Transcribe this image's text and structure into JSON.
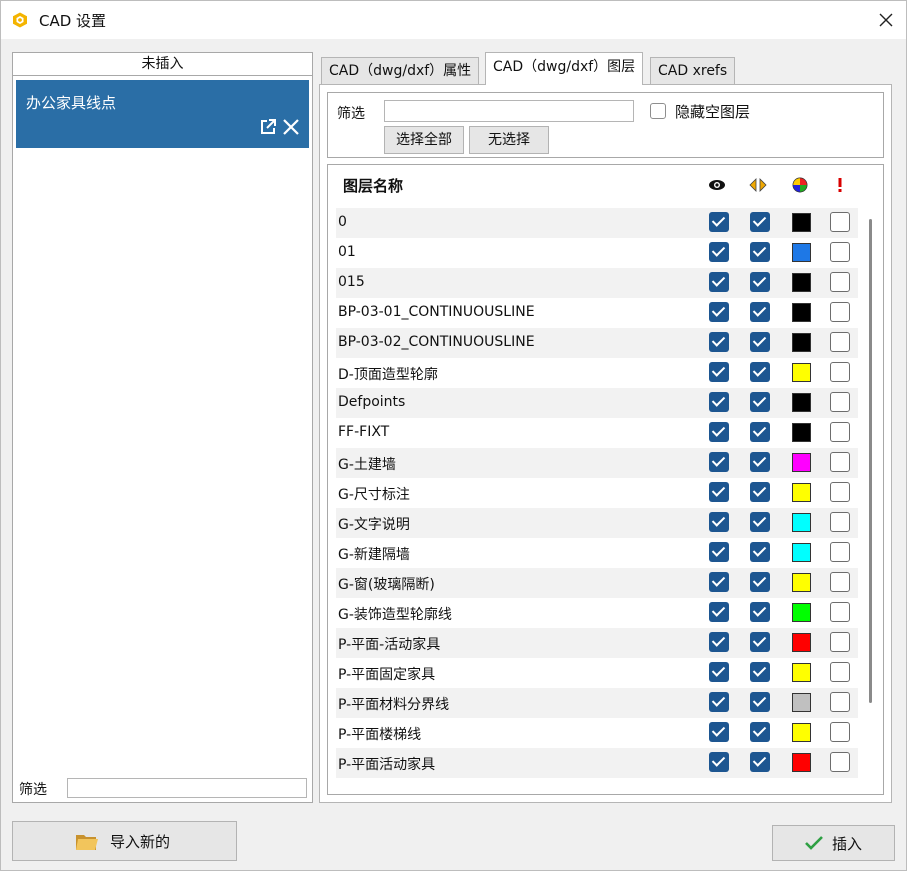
{
  "window": {
    "title": "CAD 设置"
  },
  "left": {
    "header": "未插入",
    "items": [
      {
        "label": "办公家具线点"
      }
    ],
    "filter_label": "筛选",
    "filter_value": ""
  },
  "tabs": [
    {
      "label": "CAD（dwg/dxf）属性",
      "active": false
    },
    {
      "label": "CAD（dwg/dxf）图层",
      "active": true
    },
    {
      "label": "CAD xrefs",
      "active": false
    }
  ],
  "filter": {
    "label": "筛选",
    "value": "",
    "hide_empty_label": "隐藏空图层",
    "hide_empty_checked": false,
    "select_all_label": "选择全部",
    "select_none_label": "无选择"
  },
  "table": {
    "header_name": "图层名称",
    "header_icons": [
      "eye-icon",
      "lock-icon",
      "color-wheel-icon",
      "warning-icon"
    ],
    "layers": [
      {
        "name": "0",
        "visible": true,
        "locked": true,
        "color": "#000000",
        "flag": false
      },
      {
        "name": "01",
        "visible": true,
        "locked": true,
        "color": "#1e78e6",
        "flag": false
      },
      {
        "name": "015",
        "visible": true,
        "locked": true,
        "color": "#000000",
        "flag": false
      },
      {
        "name": "BP-03-01_CONTINUOUSLINE",
        "visible": true,
        "locked": true,
        "color": "#000000",
        "flag": false
      },
      {
        "name": "BP-03-02_CONTINUOUSLINE",
        "visible": true,
        "locked": true,
        "color": "#000000",
        "flag": false
      },
      {
        "name": "D-顶面造型轮廓",
        "visible": true,
        "locked": true,
        "color": "#ffff00",
        "flag": false
      },
      {
        "name": "Defpoints",
        "visible": true,
        "locked": true,
        "color": "#000000",
        "flag": false
      },
      {
        "name": "FF-FIXT",
        "visible": true,
        "locked": true,
        "color": "#000000",
        "flag": false
      },
      {
        "name": "G-土建墙",
        "visible": true,
        "locked": true,
        "color": "#ff00ff",
        "flag": false
      },
      {
        "name": "G-尺寸标注",
        "visible": true,
        "locked": true,
        "color": "#ffff00",
        "flag": false
      },
      {
        "name": "G-文字说明",
        "visible": true,
        "locked": true,
        "color": "#00ffff",
        "flag": false
      },
      {
        "name": "G-新建隔墙",
        "visible": true,
        "locked": true,
        "color": "#00ffff",
        "flag": false
      },
      {
        "name": "G-窗(玻璃隔断)",
        "visible": true,
        "locked": true,
        "color": "#ffff00",
        "flag": false
      },
      {
        "name": "G-装饰造型轮廓线",
        "visible": true,
        "locked": true,
        "color": "#00ff00",
        "flag": false
      },
      {
        "name": "P-平面-活动家具",
        "visible": true,
        "locked": true,
        "color": "#ff0000",
        "flag": false
      },
      {
        "name": "P-平面固定家具",
        "visible": true,
        "locked": true,
        "color": "#ffff00",
        "flag": false
      },
      {
        "name": "P-平面材料分界线",
        "visible": true,
        "locked": true,
        "color": "#c0c0c0",
        "flag": false
      },
      {
        "name": "P-平面楼梯线",
        "visible": true,
        "locked": true,
        "color": "#ffff00",
        "flag": false
      },
      {
        "name": "P-平面活动家具",
        "visible": true,
        "locked": true,
        "color": "#ff0000",
        "flag": false
      }
    ]
  },
  "buttons": {
    "import_label": "导入新的",
    "insert_label": "插入"
  },
  "colors": {
    "accent": "#1d5691",
    "selected_item": "#2a6ea6"
  }
}
